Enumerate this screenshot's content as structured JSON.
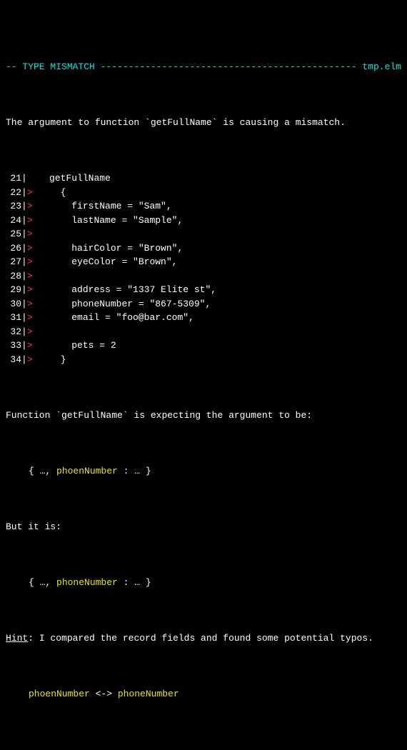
{
  "header": {
    "prefix": "-- ",
    "title": "TYPE MISMATCH",
    "sep": " -",
    "dashes": "------------------------------------------------",
    "filename": " tmp.elm"
  },
  "intro": {
    "pre": "The argument to function `",
    "fn": "getFullName",
    "post": "` is causing a mismatch."
  },
  "code": [
    {
      "n": "21",
      "marker": " ",
      "text": "   getFullName"
    },
    {
      "n": "22",
      "marker": ">",
      "text": "     {"
    },
    {
      "n": "23",
      "marker": ">",
      "text": "       firstName = \"Sam\","
    },
    {
      "n": "24",
      "marker": ">",
      "text": "       lastName = \"Sample\","
    },
    {
      "n": "25",
      "marker": ">",
      "text": ""
    },
    {
      "n": "26",
      "marker": ">",
      "text": "       hairColor = \"Brown\","
    },
    {
      "n": "27",
      "marker": ">",
      "text": "       eyeColor = \"Brown\","
    },
    {
      "n": "28",
      "marker": ">",
      "text": ""
    },
    {
      "n": "29",
      "marker": ">",
      "text": "       address = \"1337 Elite st\","
    },
    {
      "n": "30",
      "marker": ">",
      "text": "       phoneNumber = \"867-5309\","
    },
    {
      "n": "31",
      "marker": ">",
      "text": "       email = \"foo@bar.com\","
    },
    {
      "n": "32",
      "marker": ">",
      "text": ""
    },
    {
      "n": "33",
      "marker": ">",
      "text": "       pets = 2"
    },
    {
      "n": "34",
      "marker": ">",
      "text": "     }"
    }
  ],
  "expect": {
    "pre": "Function `",
    "fn": "getFullName",
    "post": "` is expecting the argument to be:"
  },
  "record1": {
    "open": "{ …, ",
    "field": "phoenNumber",
    "close": " : … }"
  },
  "butitis": "But it is:",
  "record2": {
    "open": "{ …, ",
    "field": "phoneNumber",
    "close": " : … }"
  },
  "hint": {
    "label": "Hint",
    "text": ": I compared the record fields and found some potential typos."
  },
  "typo": {
    "a": "phoenNumber",
    "arrow": " <-> ",
    "b": "phoneNumber"
  }
}
